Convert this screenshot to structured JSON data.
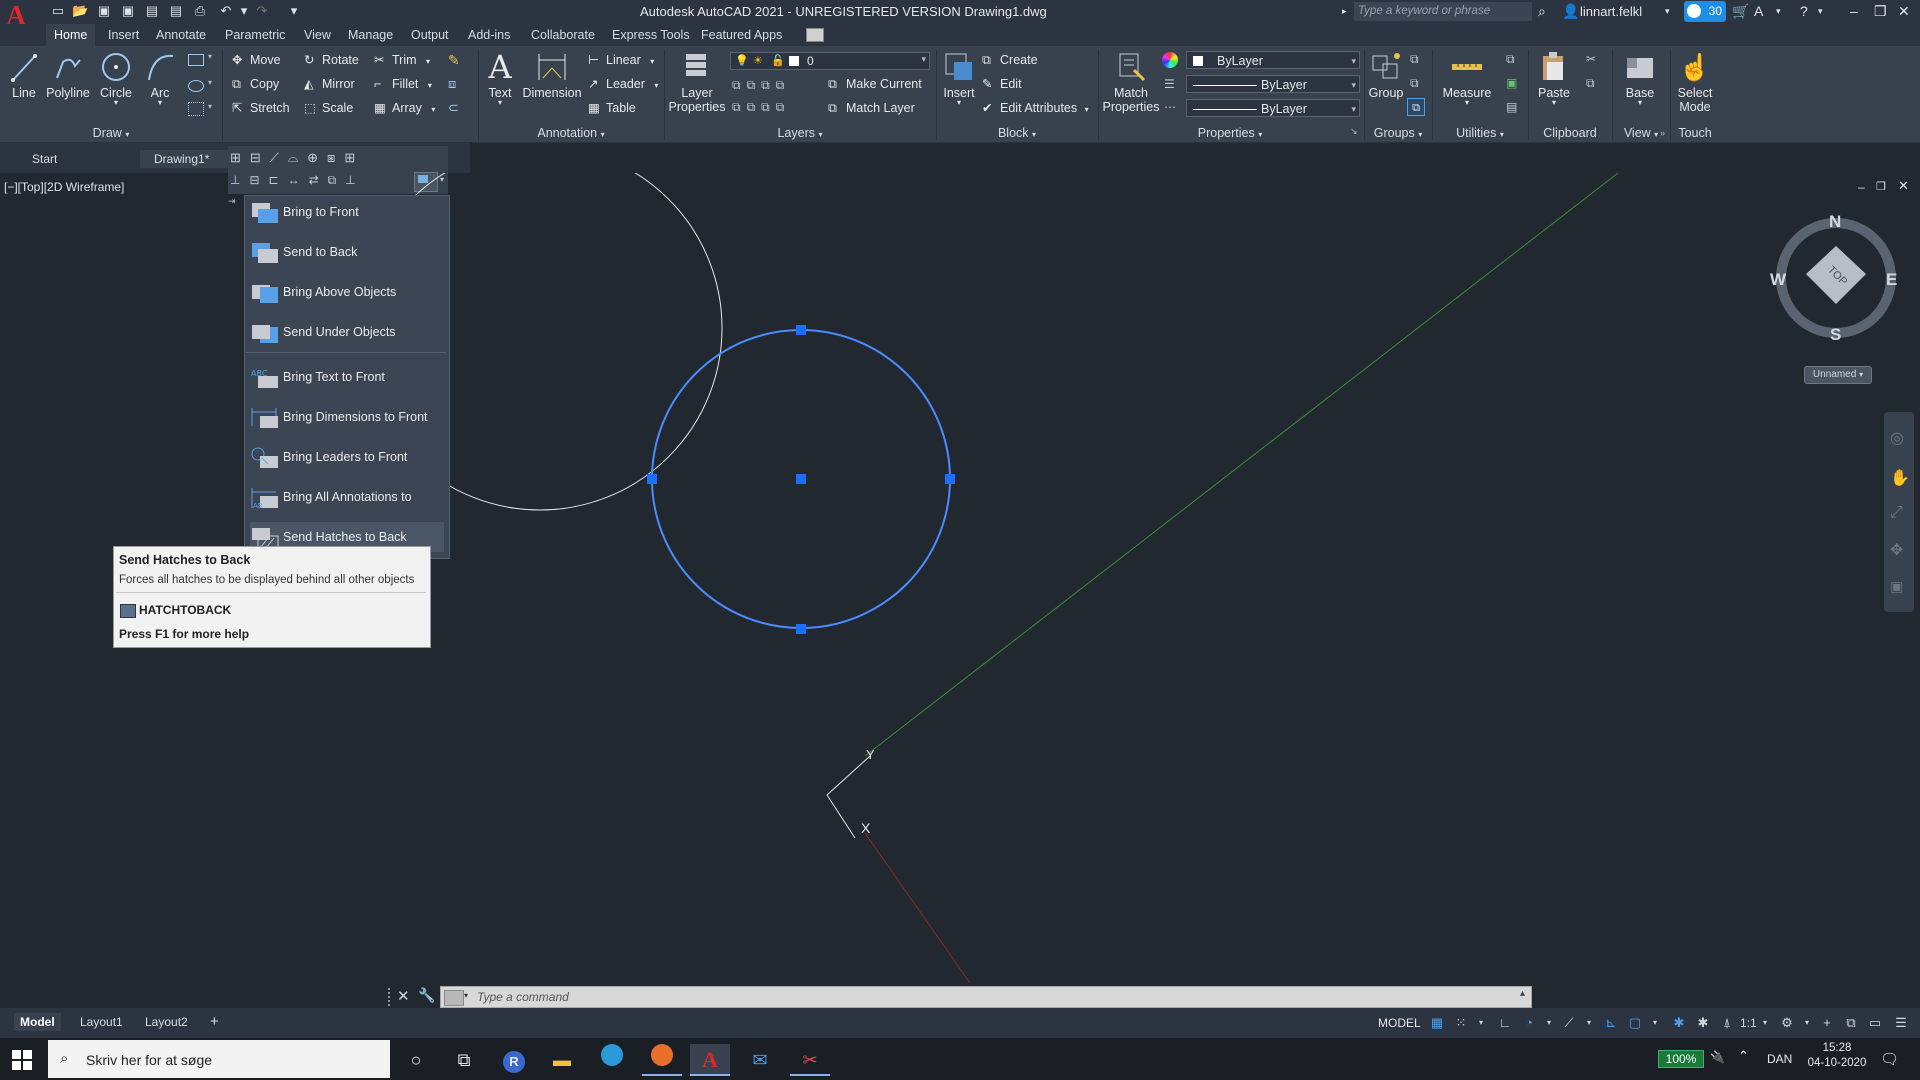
{
  "titlebar": {
    "title": "Autodesk AutoCAD 2021 - UNREGISTERED VERSION    Drawing1.dwg",
    "search_placeholder": "Type a keyword or phrase",
    "user": "linnart.felkl",
    "clock_badge": "30",
    "app_letter": "A"
  },
  "ribbon_tabs": [
    "Home",
    "Insert",
    "Annotate",
    "Parametric",
    "View",
    "Manage",
    "Output",
    "Add-ins",
    "Collaborate",
    "Express Tools",
    "Featured Apps"
  ],
  "ribbon": {
    "draw": {
      "line": "Line",
      "polyline": "Polyline",
      "circle": "Circle",
      "arc": "Arc",
      "footer": "Draw"
    },
    "modify": {
      "move": "Move",
      "rotate": "Rotate",
      "trim": "Trim",
      "copy": "Copy",
      "mirror": "Mirror",
      "fillet": "Fillet",
      "stretch": "Stretch",
      "scale": "Scale",
      "array": "Array"
    },
    "annotation": {
      "text": "Text",
      "dimension": "Dimension",
      "linear": "Linear",
      "leader": "Leader",
      "table": "Table",
      "footer": "Annotation"
    },
    "layers": {
      "layer_properties": "Layer Properties",
      "layer_value": "0",
      "make_current": "Make Current",
      "match_layer": "Match Layer",
      "footer": "Layers"
    },
    "block": {
      "insert": "Insert",
      "create": "Create",
      "edit": "Edit",
      "edit_attributes": "Edit Attributes",
      "footer": "Block"
    },
    "properties": {
      "match_properties": "Match Properties",
      "color": "ByLayer",
      "linetype": "ByLayer",
      "lineweight": "ByLayer",
      "footer": "Properties"
    },
    "groups": {
      "group": "Group",
      "footer": "Groups"
    },
    "utilities": {
      "measure": "Measure",
      "footer": "Utilities"
    },
    "clipboard": {
      "paste": "Paste",
      "footer": "Clipboard"
    },
    "view": {
      "base": "Base",
      "footer": "View"
    },
    "touch": {
      "select_mode": "Select Mode",
      "footer": "Touch"
    }
  },
  "file_tabs": {
    "start": "Start",
    "drawing": "Drawing1*"
  },
  "viewport_label": "[−][Top][2D Wireframe]",
  "draworder_menu": {
    "items": [
      "Bring to Front",
      "Send to Back",
      "Bring Above Objects",
      "Send Under Objects",
      "Bring Text to Front",
      "Bring Dimensions to Front",
      "Bring Leaders to Front",
      "Bring All Annotations to Front",
      "Send Hatches to Back"
    ]
  },
  "tooltip": {
    "title": "Send Hatches to Back",
    "description": "Forces all hatches to be displayed behind all other objects",
    "command": "HATCHTOBACK",
    "help": "Press F1 for more help"
  },
  "viewcube": {
    "n": "N",
    "s": "S",
    "e": "E",
    "w": "W",
    "face": "TOP",
    "ucs": "Unnamed"
  },
  "ucs_icon": {
    "x": "X",
    "y": "Y"
  },
  "command_line": {
    "placeholder": "Type  a  command"
  },
  "layout_tabs": [
    "Model",
    "Layout1",
    "Layout2"
  ],
  "status": {
    "model": "MODEL",
    "scale": "1:1"
  },
  "taskbar": {
    "search": "Skriv her for at søge",
    "battery": "100%",
    "lang": "DAN",
    "time": "15:28",
    "date": "04-10-2020"
  },
  "colors": {
    "selection_blue": "#4a8cff",
    "grip_blue": "#1a6fff",
    "background": "#212830",
    "ribbon": "#38424f"
  }
}
